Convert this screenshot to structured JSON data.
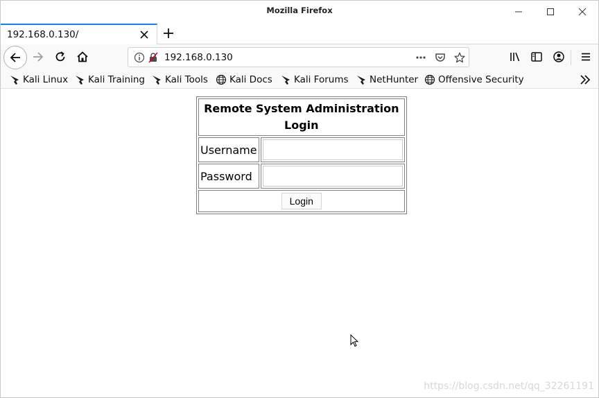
{
  "window": {
    "title": "Mozilla Firefox"
  },
  "tab": {
    "label": "192.168.0.130/"
  },
  "urlbar": {
    "url": "192.168.0.130"
  },
  "bookmarks": [
    {
      "label": "Kali Linux",
      "icon": "kali-dragon-icon"
    },
    {
      "label": "Kali Training",
      "icon": "kali-dragon-icon"
    },
    {
      "label": "Kali Tools",
      "icon": "kali-dragon-icon"
    },
    {
      "label": "Kali Docs",
      "icon": "globe-icon"
    },
    {
      "label": "Kali Forums",
      "icon": "kali-dragon-icon"
    },
    {
      "label": "NetHunter",
      "icon": "kali-dragon-icon"
    },
    {
      "label": "Offensive Security",
      "icon": "globe-icon"
    }
  ],
  "login_form": {
    "title": "Remote System Administration Login",
    "username_label": "Username",
    "password_label": "Password",
    "username_value": "",
    "password_value": "",
    "button_label": "Login"
  },
  "watermark": "https://blog.csdn.net/qq_32261191",
  "colors": {
    "tab_accent": "#0a84ff",
    "toolbar_bg": "#f9f9fa"
  }
}
